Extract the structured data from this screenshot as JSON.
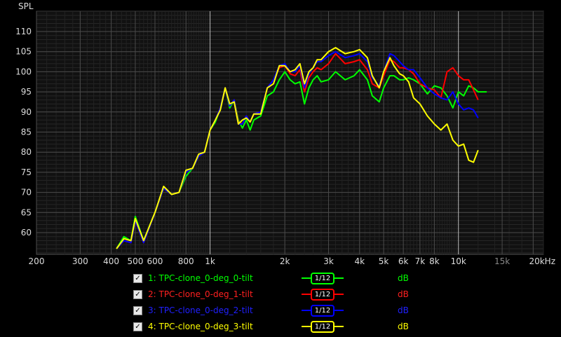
{
  "chart_data": {
    "type": "line",
    "ylabel": "SPL",
    "xscale": "log",
    "xlim": [
      200,
      22000
    ],
    "ylim": [
      55,
      115
    ],
    "x_ticks": [
      {
        "value": 200,
        "label": "200"
      },
      {
        "value": 300,
        "label": "300"
      },
      {
        "value": 400,
        "label": "400"
      },
      {
        "value": 500,
        "label": "500"
      },
      {
        "value": 600,
        "label": "600"
      },
      {
        "value": 800,
        "label": "800"
      },
      {
        "value": 1000,
        "label": "1k"
      },
      {
        "value": 2000,
        "label": "2k"
      },
      {
        "value": 3000,
        "label": "3k"
      },
      {
        "value": 4000,
        "label": "4k"
      },
      {
        "value": 5000,
        "label": "5k"
      },
      {
        "value": 6000,
        "label": "6k"
      },
      {
        "value": 7000,
        "label": "7k"
      },
      {
        "value": 8000,
        "label": "8k"
      },
      {
        "value": 10000,
        "label": "10k"
      },
      {
        "value": 15000,
        "label": "15k"
      },
      {
        "value": 20000,
        "label": "20kHz"
      }
    ],
    "y_ticks": [
      60,
      65,
      70,
      75,
      80,
      85,
      90,
      95,
      100,
      105,
      110
    ],
    "x": [
      420,
      450,
      480,
      500,
      540,
      600,
      650,
      700,
      750,
      800,
      850,
      900,
      950,
      1000,
      1050,
      1100,
      1150,
      1200,
      1250,
      1300,
      1350,
      1400,
      1450,
      1500,
      1600,
      1700,
      1800,
      1900,
      2000,
      2100,
      2200,
      2300,
      2400,
      2500,
      2600,
      2700,
      2800,
      3000,
      3200,
      3500,
      3800,
      4000,
      4300,
      4500,
      4800,
      5000,
      5300,
      5500,
      5800,
      6000,
      6300,
      6600,
      7000,
      7500,
      8000,
      8500,
      9000,
      9500,
      10000,
      10500,
      11000,
      11500,
      12000,
      13000,
      14000,
      15000,
      16000,
      17000,
      18000,
      19000,
      20000,
      21000,
      22000
    ],
    "series": [
      {
        "name": "1: TPC-clone_0-deg_0-tilt",
        "color": "#00ff00",
        "values": [
          56,
          59,
          58,
          64,
          58,
          65,
          71,
          69.5,
          70,
          74,
          76,
          79,
          80,
          85.5,
          87.5,
          91,
          96,
          91,
          93,
          88,
          86,
          88,
          85.5,
          88,
          89,
          94,
          95,
          98,
          100,
          98,
          97,
          97.5,
          92,
          96,
          98,
          99,
          97.5,
          98,
          100,
          98,
          99,
          100.5,
          98,
          94,
          92.5,
          96,
          99,
          99,
          98,
          98,
          98.5,
          98,
          97,
          94.5,
          96.5,
          96,
          94,
          91,
          95,
          94,
          96.5,
          96,
          95,
          95
        ]
      },
      {
        "name": "2: TPC-clone_0-deg_1-tilt",
        "color": "#ff0000",
        "values": [
          56,
          58,
          57.5,
          63,
          57.5,
          65,
          71,
          69.5,
          70,
          75,
          76,
          79,
          80,
          85.5,
          88,
          91,
          96,
          91.5,
          93,
          87.5,
          87,
          89,
          87.5,
          89.5,
          90,
          96,
          98,
          101,
          101.5,
          99.5,
          99,
          100.5,
          95,
          98.5,
          100,
          101,
          100.5,
          102,
          104.5,
          102,
          102.5,
          103,
          100.5,
          97,
          96,
          99,
          103,
          102.5,
          101,
          101,
          100.5,
          99.5,
          97,
          96,
          95.5,
          93.5,
          100,
          101,
          99,
          98,
          98,
          95.5,
          93
        ]
      },
      {
        "name": "3: TPC-clone_0-deg_2-tilt",
        "color": "#0000ff",
        "values": [
          56,
          58,
          57.5,
          63,
          57.5,
          65,
          71,
          69.5,
          70,
          75,
          76,
          79,
          80,
          85.5,
          88,
          91,
          96,
          91.5,
          93,
          87,
          87,
          89,
          87.5,
          89.5,
          90,
          96,
          98,
          101.5,
          102,
          100,
          100,
          101.5,
          96,
          99.5,
          101,
          102.5,
          102.5,
          104,
          105,
          103.5,
          104,
          104.5,
          102.5,
          98.5,
          96.5,
          100,
          104.5,
          104,
          102.5,
          101.5,
          100.5,
          100.5,
          98.5,
          96,
          94.5,
          93.5,
          93,
          95,
          92,
          90.5,
          91,
          90.5,
          88.5
        ]
      },
      {
        "name": "4: TPC-clone_0-deg_3-tilt",
        "color": "#ffff00",
        "values": [
          56,
          58.5,
          58,
          63.5,
          58,
          65,
          71.5,
          69.5,
          70,
          75.5,
          76,
          79.5,
          80,
          85.5,
          88,
          90.5,
          96,
          92,
          92.5,
          87,
          88,
          88.5,
          87.5,
          89.5,
          89.5,
          96,
          97,
          101.5,
          101.5,
          100,
          100.5,
          102,
          97,
          100,
          101,
          103,
          103,
          105,
          106,
          104.5,
          105,
          105.5,
          103.5,
          99,
          96,
          100,
          103.5,
          101.5,
          99.5,
          99,
          97.5,
          93.5,
          92,
          89,
          87,
          85.5,
          87,
          83,
          81.5,
          82,
          78,
          77.5,
          80.5
        ]
      }
    ]
  },
  "legend": [
    {
      "label": "1: TPC-clone_0-deg_0-tilt",
      "color": "#00ff00",
      "checked": "✓",
      "smoothing": "1/12",
      "unit": "dB"
    },
    {
      "label": "2: TPC-clone_0-deg_1-tilt",
      "color": "#ff2020",
      "checked": "✓",
      "smoothing": "1/12",
      "unit": "dB"
    },
    {
      "label": "3: TPC-clone_0-deg_2-tilt",
      "color": "#2020ff",
      "checked": "✓",
      "smoothing": "1/12",
      "unit": "dB"
    },
    {
      "label": "4: TPC-clone_0-deg_3-tilt",
      "color": "#ffff00",
      "checked": "✓",
      "smoothing": "1/12",
      "unit": "dB"
    }
  ]
}
